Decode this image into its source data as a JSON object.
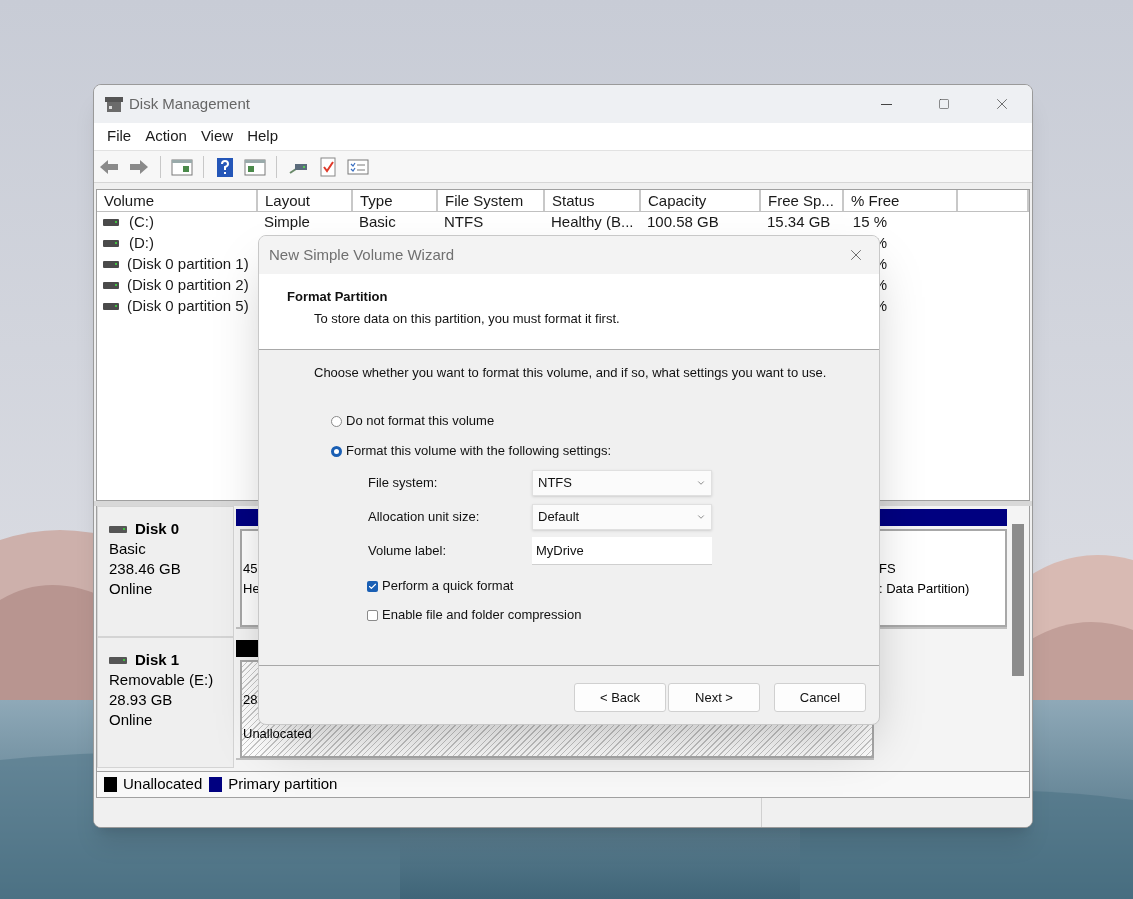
{
  "window": {
    "title": "Disk Management",
    "menu": [
      "File",
      "Action",
      "View",
      "Help"
    ]
  },
  "table": {
    "columns": [
      "Volume",
      "Layout",
      "Type",
      "File System",
      "Status",
      "Capacity",
      "Free Sp...",
      "% Free"
    ],
    "rows": [
      {
        "volume": "(C:)",
        "layout": "Simple",
        "type": "Basic",
        "file_system": "NTFS",
        "status": "Healthy (B...",
        "capacity": "100.58 GB",
        "free_space": "15.34 GB",
        "percent_free": "15 %"
      },
      {
        "volume": "(D:)",
        "percent_free": "%"
      },
      {
        "volume": "(Disk 0 partition 1)",
        "percent_free": "%"
      },
      {
        "volume": "(Disk 0 partition 2)",
        "percent_free": "%"
      },
      {
        "volume": "(Disk 0 partition 5)",
        "percent_free": "%"
      }
    ]
  },
  "disks": [
    {
      "name": "Disk 0",
      "type": "Basic",
      "size": "238.46 GB",
      "status": "Online",
      "partitions": [
        {
          "kind": "primary",
          "lines": [
            "45",
            "He"
          ]
        },
        {
          "kind": "primary",
          "lines": [
            "FS",
            ": Data Partition)"
          ]
        }
      ]
    },
    {
      "name": "Disk 1",
      "type": "Removable (E:)",
      "size": "28.93 GB",
      "status": "Online",
      "partitions": [
        {
          "kind": "unallocated",
          "lines": [
            "28",
            "Unallocated"
          ]
        }
      ]
    }
  ],
  "legend": [
    {
      "label": "Unallocated",
      "color": "#000000"
    },
    {
      "label": "Primary partition",
      "color": "#000080"
    }
  ],
  "dialog": {
    "title": "New Simple Volume Wizard",
    "heading": "Format Partition",
    "subheading": "To store data on this partition, you must format it first.",
    "instruction": "Choose whether you want to format this volume, and if so, what settings you want to use.",
    "options": [
      {
        "label": "Do not format this volume",
        "selected": false
      },
      {
        "label": "Format this volume with the following settings:",
        "selected": true
      }
    ],
    "fields": [
      {
        "kind": "dropdown",
        "label": "File system:",
        "value": "NTFS"
      },
      {
        "kind": "dropdown",
        "label": "Allocation unit size:",
        "value": "Default"
      },
      {
        "kind": "text",
        "label": "Volume label:",
        "value": "MyDrive"
      }
    ],
    "checkboxes": [
      {
        "label": "Perform a quick format",
        "checked": true
      },
      {
        "label": "Enable file and folder compression",
        "checked": false
      }
    ],
    "buttons": [
      "< Back",
      "Next >",
      "Cancel"
    ]
  }
}
